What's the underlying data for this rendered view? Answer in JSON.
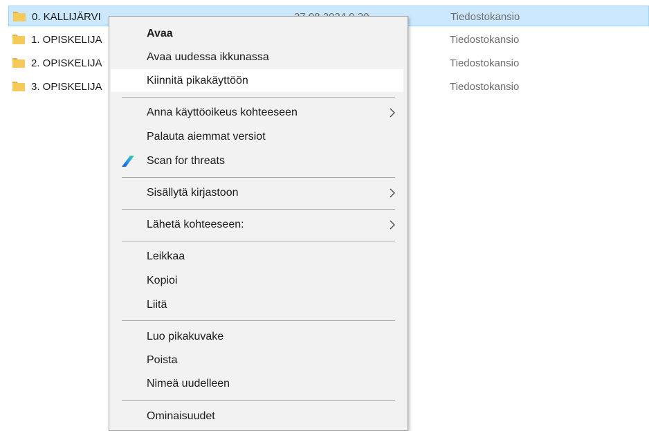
{
  "files": [
    {
      "name": "0. KALLIJÄRVI",
      "date": "27.08.2024 9.20",
      "type": "Tiedostokansio",
      "selected": true
    },
    {
      "name": "1. OPISKELIJA",
      "date": "",
      "type": "Tiedostokansio",
      "selected": false
    },
    {
      "name": "2. OPISKELIJA",
      "date": "",
      "type": "Tiedostokansio",
      "selected": false
    },
    {
      "name": "3. OPISKELIJA",
      "date": "",
      "type": "Tiedostokansio",
      "selected": false
    }
  ],
  "context_menu": {
    "open": "Avaa",
    "open_new_window": "Avaa uudessa ikkunassa",
    "pin_quick_access": "Kiinnitä pikakäyttöön",
    "give_access": "Anna käyttöoikeus kohteeseen",
    "restore_versions": "Palauta aiemmat versiot",
    "scan_threats": "Scan for threats",
    "include_library": "Sisällytä kirjastoon",
    "send_to": "Lähetä kohteeseen:",
    "cut": "Leikkaa",
    "copy": "Kopioi",
    "paste": "Liitä",
    "create_shortcut": "Luo pikakuvake",
    "delete": "Poista",
    "rename": "Nimeä uudelleen",
    "properties": "Ominaisuudet"
  },
  "colors": {
    "selection_bg": "#cce8ff",
    "selection_border": "#99d1ff",
    "menu_bg": "#f2f2f2",
    "folder": "#f5c04a"
  },
  "icons": {
    "folder": "folder-icon",
    "scan": "defender-scan-icon",
    "submenu": "chevron-right-icon"
  }
}
